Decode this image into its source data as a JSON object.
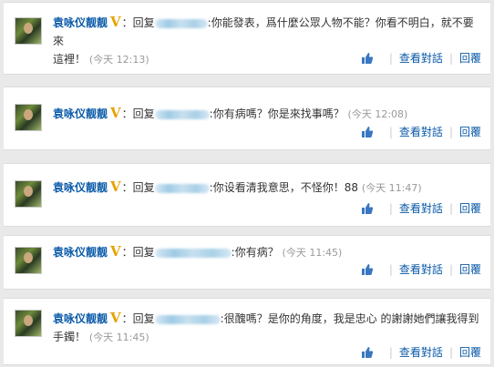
{
  "comments": [
    {
      "author": "袁咏仪靓靓",
      "prefix": "：回复",
      "message": ":你能發表，爲什麼公眾人物不能？你看不明白，就不要來這裡！",
      "message_line1": ":你能發表，爲什麼公眾人物不能？你看不明白，就不要來",
      "message_line2": "這裡！",
      "time": "(今天 12:13)"
    },
    {
      "author": "袁咏仪靓靓",
      "prefix": "：回复",
      "message": ":你有病嗎？你是來找事嗎？",
      "time": "(今天 12:08)"
    },
    {
      "author": "袁咏仪靓靓",
      "prefix": "：回复",
      "message": ":你设看清我意思，不怪你！88",
      "time": "(今天 11:47)"
    },
    {
      "author": "袁咏仪靓靓",
      "prefix": "：回复",
      "message": ":你有病？",
      "time": "(今天 11:45)"
    },
    {
      "author": "袁咏仪靓靓",
      "prefix": "：回复",
      "message": ":很醜嗎？是你的角度，我是忠心 的謝謝她們讓我得到手鐲！",
      "message_line1": ":很醜嗎？是你的角度，我是忠心 的謝謝她們讓我得到",
      "message_line2": "手鐲！",
      "time": "(今天 11:45)"
    }
  ],
  "actions": {
    "view_conversation": "查看對話",
    "reply": "回覆",
    "separator": "|"
  },
  "badge": "V",
  "icons": {
    "like": "thumbs-up-icon",
    "verified": "verified-v-icon",
    "avatar": "user-avatar"
  },
  "colors": {
    "author": "#0a5aa8",
    "badge": "#e6a200",
    "timestamp": "#999999",
    "link": "#0a5aa8",
    "background": "#e9e9e9"
  }
}
